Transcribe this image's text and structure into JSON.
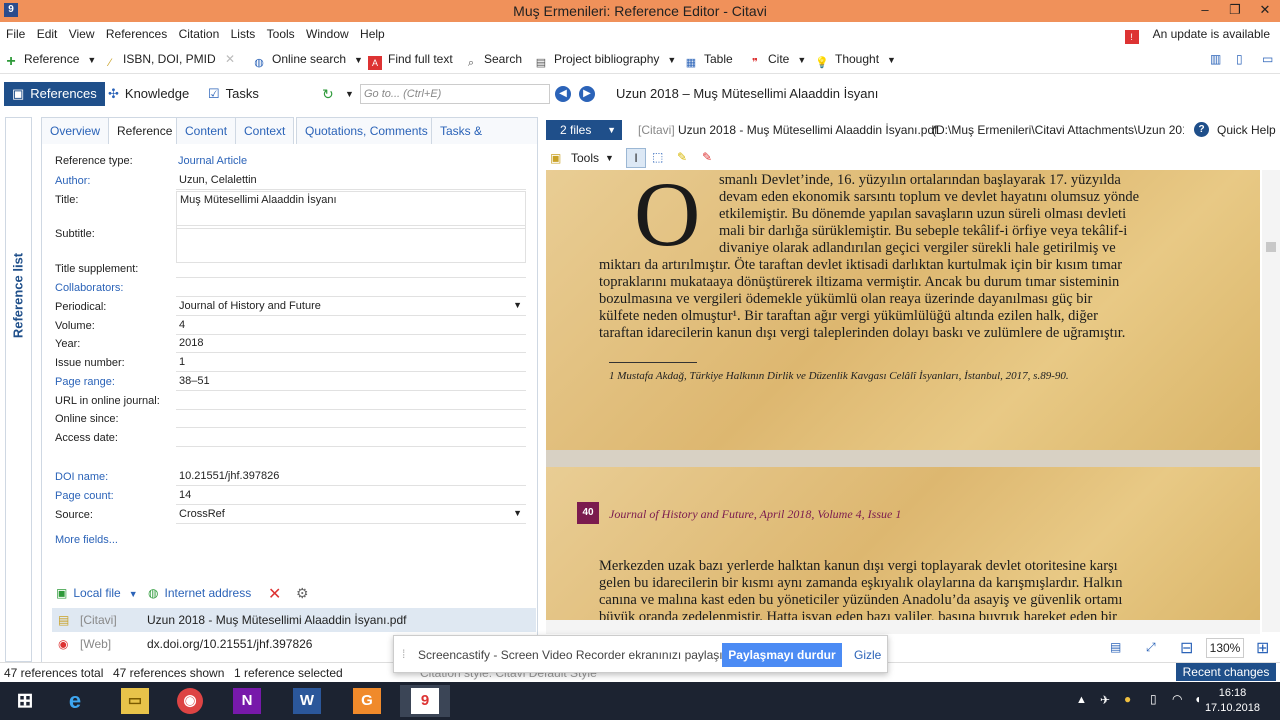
{
  "window": {
    "title": "Muş Ermenileri: Reference Editor - Citavi"
  },
  "menu": {
    "items": [
      "File",
      "Edit",
      "View",
      "References",
      "Citation",
      "Lists",
      "Tools",
      "Window",
      "Help"
    ],
    "update": "An update is available"
  },
  "toolbar": {
    "reference": "Reference",
    "isbn": "ISBN, DOI, PMID",
    "online_search": "Online search",
    "find_full_text": "Find full text",
    "search": "Search",
    "project_bibliography": "Project bibliography",
    "table": "Table",
    "cite": "Cite",
    "thought": "Thought"
  },
  "nav": {
    "tabs": [
      "References",
      "Knowledge",
      "Tasks"
    ],
    "goto_placeholder": "Go to... (Ctrl+E)",
    "current_title": "Uzun 2018 – Muş Mütesellimi Alaaddin İsyanı"
  },
  "sidebar": {
    "label": "Reference list"
  },
  "editor": {
    "tabs": [
      "Overview",
      "Reference",
      "Content",
      "Context",
      "Quotations, Comments",
      "Tasks & locations"
    ],
    "fields": {
      "reference_type": {
        "label": "Reference type:",
        "value": "Journal Article"
      },
      "author": {
        "label": "Author:",
        "value": "Uzun, Celalettin"
      },
      "title": {
        "label": "Title:",
        "value": "Muş Mütesellimi Alaaddin İsyanı"
      },
      "subtitle": {
        "label": "Subtitle:",
        "value": ""
      },
      "title_supplement": {
        "label": "Title supplement:",
        "value": ""
      },
      "collaborators": {
        "label": "Collaborators:",
        "value": ""
      },
      "periodical": {
        "label": "Periodical:",
        "value": "Journal of History and Future"
      },
      "volume": {
        "label": "Volume:",
        "value": "4"
      },
      "year": {
        "label": "Year:",
        "value": "2018"
      },
      "issue_number": {
        "label": "Issue number:",
        "value": "1"
      },
      "page_range": {
        "label": "Page range:",
        "value": "38–51"
      },
      "url": {
        "label": "URL in online journal:",
        "value": ""
      },
      "online_since": {
        "label": "Online since:",
        "value": ""
      },
      "access_date": {
        "label": "Access date:",
        "value": ""
      },
      "doi": {
        "label": "DOI name:",
        "value": "10.21551/jhf.397826"
      },
      "page_count": {
        "label": "Page count:",
        "value": "14"
      },
      "source": {
        "label": "Source:",
        "value": "CrossRef"
      }
    },
    "more_fields": "More fields...",
    "links": {
      "local_file": "Local file",
      "internet_address": "Internet address",
      "rows": [
        {
          "tag": "[Citavi]",
          "name": "Uzun 2018 - Muş Mütesellimi Alaaddin İsyanı.pdf"
        },
        {
          "tag": "[Web]",
          "name": "dx.doi.org/10.21551/jhf.397826"
        }
      ]
    }
  },
  "preview": {
    "files_button": "2 files",
    "tag": "[Citavi]",
    "filename": "Uzun 2018 - Muş Mütesellimi Alaaddin İsyanı.pdf",
    "path": "(D:\\Muş Ermenileri\\Citavi Attachments\\Uzun 201",
    "quick_help": "Quick Help",
    "tools": "Tools",
    "dropcap": "O",
    "para1_lines": [
      "smanlı Devlet’inde, 16. yüzyılın ortalarından başlayarak 17. yüzyılda",
      "devam eden ekonomik sarsıntı toplum ve devlet hayatını olumsuz yönde",
      "etkilemiştir. Bu dönemde yapılan savaşların uzun süreli olması devleti",
      "mali bir darlığa sürüklemiştir. Bu sebeple tekâlif-i örfiye veya tekâlif-i",
      "divaniye olarak adlandırılan geçici vergiler sürekli hale getirilmiş ve"
    ],
    "para2_lines": [
      "miktarı da artırılmıştır. Öte taraftan devlet iktisadi darlıktan kurtulmak için bir kısım tımar",
      "topraklarını mukataaya dönüştürerek iltizama vermiştir. Ancak bu durum tımar sisteminin",
      "bozulmasına ve vergileri ödemekle yükümlü olan reaya üzerinde dayanılması güç bir",
      "külfete neden olmuştur¹. Bir taraftan ağır vergi yükümlülüğü altında ezilen halk, diğer",
      "taraftan idarecilerin kanun dışı vergi taleplerinden dolayı baskı ve zulümlere de uğramıştır."
    ],
    "footnote": "1    Mustafa Akdağ, Türkiye Halkının Dirlik ve Düzenlik Kavgası Celâlî İsyanları, İstanbul, 2017, s.89-90.",
    "page_number": "40",
    "running_header": "Journal of History and Future, April 2018, Volume 4, Issue 1",
    "page2_lines": [
      "Merkezden uzak bazı yerlerde halktan kanun dışı vergi toplayarak devlet otoritesine karşı",
      "gelen bu idarecilerin bir kısmı aynı zamanda eşkıyalık olaylarına da karışmışlardır. Halkın",
      "canına ve malına kast eden bu yöneticiler yüzünden Anadolu’da asayiş ve güvenlik ortamı",
      "büyük oranda zedelenmiştir. Hatta isyan eden bazı valiler, başına buyruk hareket eden bir"
    ],
    "zoom": "130%"
  },
  "status": {
    "total": "47 references total",
    "shown": "47 references shown",
    "selected": "1 reference selected",
    "citation_style": "Citation style: Citavi Default Style",
    "recent_changes": "Recent changes"
  },
  "toast": {
    "message": "Screencastify - Screen Video Recorder ekranınızı paylaşıyor.",
    "stop": "Paylaşmayı durdur",
    "hide": "Gizle"
  },
  "taskbar": {
    "time": "16:18",
    "date": "17.10.2018"
  },
  "colors": {
    "accent": "#1f4f8a",
    "titlebar": "#f0915a",
    "link": "#2b63b8"
  }
}
